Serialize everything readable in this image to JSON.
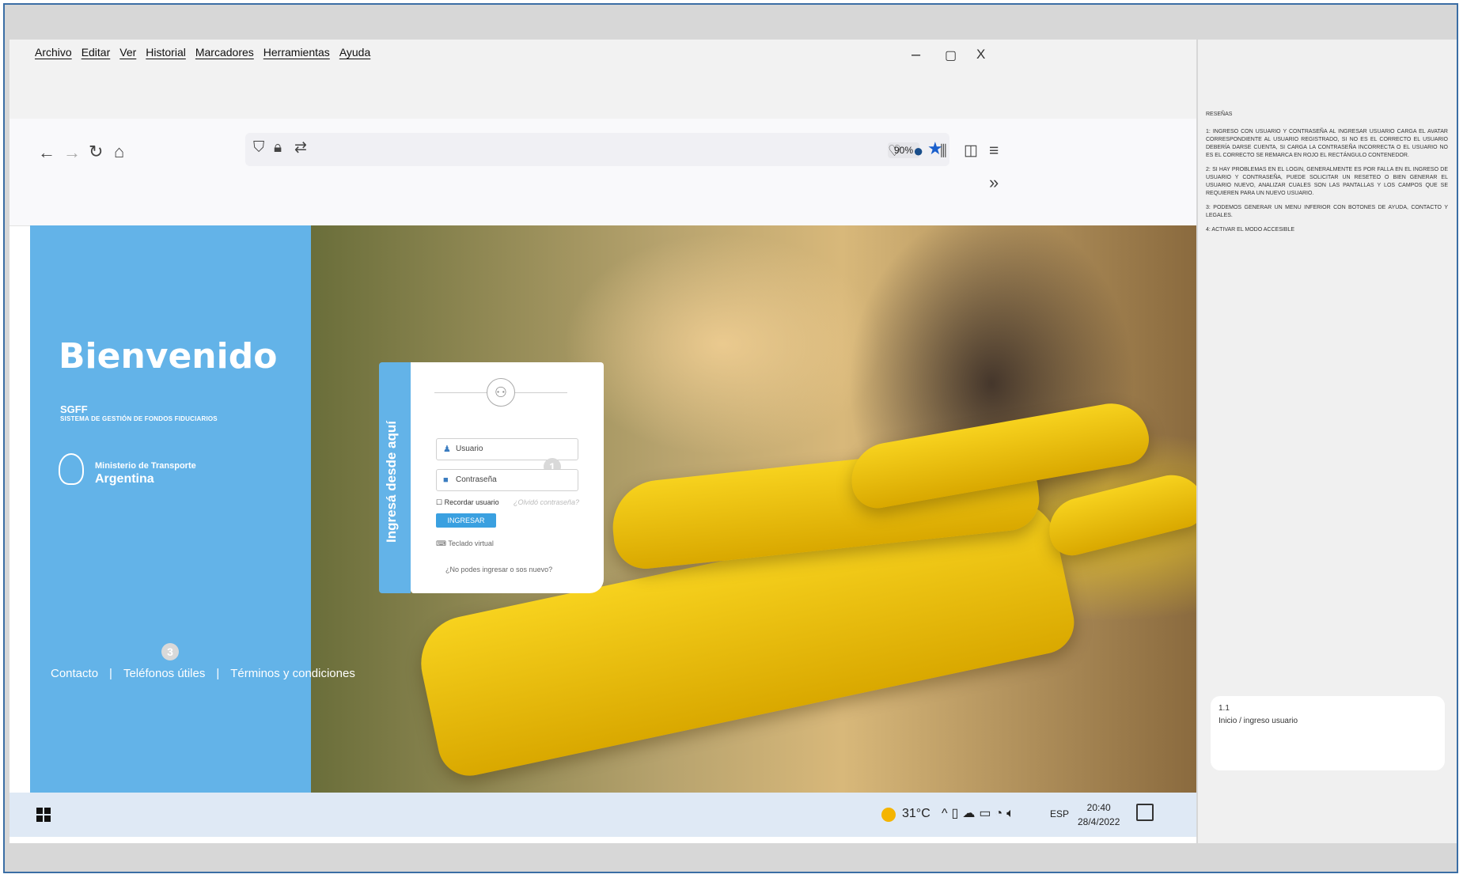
{
  "menu": {
    "items": [
      "Archivo",
      "Editar",
      "Ver",
      "Historial",
      "Marcadores",
      "Herramientas",
      "Ayuda"
    ]
  },
  "window_controls": {
    "minimize": "–",
    "restore": "▢",
    "close": "X"
  },
  "toolbar": {
    "zoom": "90%",
    "overflow": "»"
  },
  "welcome": {
    "title": "Bienvenido",
    "subtitle": "SGFF",
    "subtitle_full": "SISTEMA DE GESTIÓN DE FONDOS FIDUCIARIOS",
    "ministry_line1": "Ministerio de Transporte",
    "ministry_line2": "Argentina"
  },
  "login": {
    "tab_label": "Ingresá desde aquí",
    "username_placeholder": "Usuario",
    "password_placeholder": "Contraseña",
    "remember_label": "Recordar usuario",
    "forgot_link": "¿Olvidó contraseña?",
    "submit_label": "INGRESAR",
    "virtual_keyboard": "Teclado virtual",
    "cannot_login_link": "¿No podes ingresar o sos nuevo?"
  },
  "markers": {
    "m1": "1",
    "m3": "3"
  },
  "footer": {
    "contact": "Contacto",
    "sep": "|",
    "phones": "Teléfonos útiles",
    "terms": "Términos y condiciones"
  },
  "taskbar": {
    "temperature": "31°C",
    "language": "ESP",
    "time": "20:40",
    "date": "28/4/2022"
  },
  "notes": {
    "title": "RESEÑAS",
    "items": [
      "1: INGRESO CON USUARIO Y CONTRASEÑA AL INGRESAR USUARIO CARGA EL AVATAR CORRESPONDIENTE AL USUARIO REGISTRADO, SI NO ES EL CORRECTO EL USUARIO DEBERÍA DARSE CUENTA, SI CARGA LA CONTRASEÑA INCORRECTA O EL USUARIO NO ES EL CORRECTO SE REMARCA EN ROJO EL RECTÁNGULO CONTENEDOR.",
      "2: SI HAY PROBLEMAS EN EL LOGIN, GENERALMENTE ES POR FALLA EN EL INGRESO DE USUARIO Y CONTRASEÑA, PUEDE SOLICITAR UN RESETEO O BIEN GENERAR EL USUARIO NUEVO, ANALIZAR CUALES SON LAS PANTALLAS Y LOS CAMPOS QUE SE REQUIEREN PARA UN NUEVO USUARIO.",
      "3: PODEMOS GENERAR UN MENU INFERIOR CON BOTONES DE AYUDA, CONTACTO Y LEGALES.",
      "4: ACTIVAR EL MODO ACCESIBLE"
    ]
  },
  "note_card": {
    "number": "1.1",
    "label": "Inicio / ingreso usuario"
  }
}
